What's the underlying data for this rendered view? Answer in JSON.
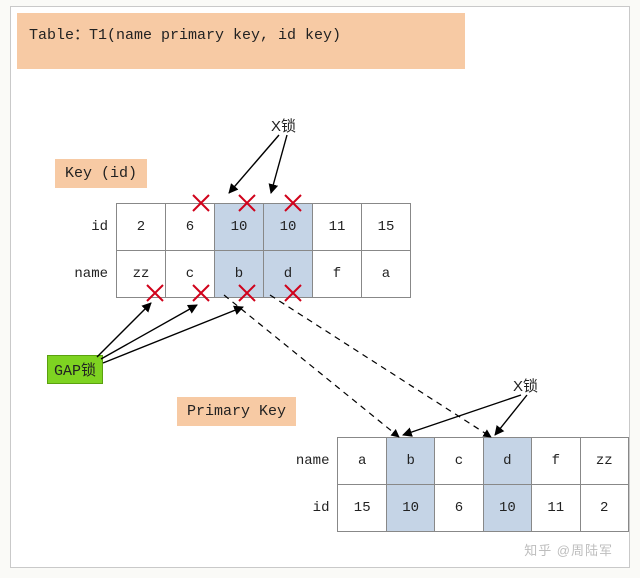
{
  "title": "Table：T1(name primary key, id key)",
  "labels": {
    "key_id": "Key (id)",
    "primary_key": "Primary Key",
    "xlock_top": "X锁",
    "xlock_bottom": "X锁",
    "gap_lock": "GAP锁"
  },
  "index_table": {
    "row_labels": [
      "id",
      "name"
    ],
    "rows": [
      [
        "2",
        "6",
        "10",
        "10",
        "11",
        "15"
      ],
      [
        "zz",
        "c",
        "b",
        "d",
        "f",
        "a"
      ]
    ],
    "highlight_cols": [
      2,
      3
    ]
  },
  "primary_table": {
    "row_labels": [
      "name",
      "id"
    ],
    "rows": [
      [
        "a",
        "b",
        "c",
        "d",
        "f",
        "zz"
      ],
      [
        "15",
        "10",
        "6",
        "10",
        "11",
        "2"
      ]
    ],
    "highlight_cols": [
      1,
      3
    ]
  },
  "watermark": "知乎 @周陆军"
}
